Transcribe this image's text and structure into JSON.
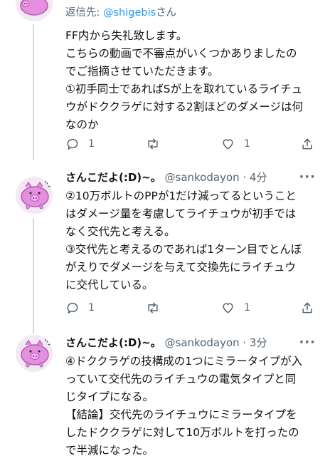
{
  "tweets": [
    {
      "reply_prefix": "返信先: ",
      "reply_handle": "@shigebis",
      "reply_suffix": "さん",
      "lines": [
        "FF内から失礼致します。",
        "こちらの動画で不審点がいくつかありましたの",
        "でご指摘させていただきます。",
        "①初手同士であればSが上を取れているライチュ",
        "ウがドククラゲに対する2割ほどのダメージは何",
        "なのか"
      ],
      "actions": {
        "reply_count": "1",
        "like_count": "1"
      }
    },
    {
      "name": "さんこだよ(:D)~。",
      "handle_time": "@sankodayon · 4分",
      "lines": [
        "②10万ボルトのPPが1だけ減ってるということ",
        "はダメージ量を考慮してライチュウが初手では",
        "なく交代先と考える。",
        "③交代先と考えるのであれば1ターン目でとんぼ",
        "がえりでダメージを与えて交換先にライチュウ",
        "に交代している。"
      ],
      "actions": {
        "reply_count": "1",
        "like_count": "1"
      }
    },
    {
      "name": "さんこだよ(:D)~。",
      "handle_time": "@sankodayon · 3分",
      "lines": [
        "④ドククラゲの技構成の1つにミラータイプが入",
        "っていて交代先のライチュウの電気タイプと同",
        "じタイプになる。",
        "【結論】交代先のライチュウにミラータイプを",
        "したドククラゲに対して10万ボルトを打ったの",
        "で半減になった。"
      ]
    }
  ],
  "icons": {
    "more": "more-horizontal-icon",
    "reply": "reply-bubble-icon",
    "retweet": "retweet-icon",
    "like": "heart-icon",
    "share": "share-icon"
  },
  "colors": {
    "text": "#0f1419",
    "secondary": "#536471",
    "link": "#1d9bf0",
    "thread_line": "#cfd9de",
    "avatar_pink": "#e58fe0"
  }
}
